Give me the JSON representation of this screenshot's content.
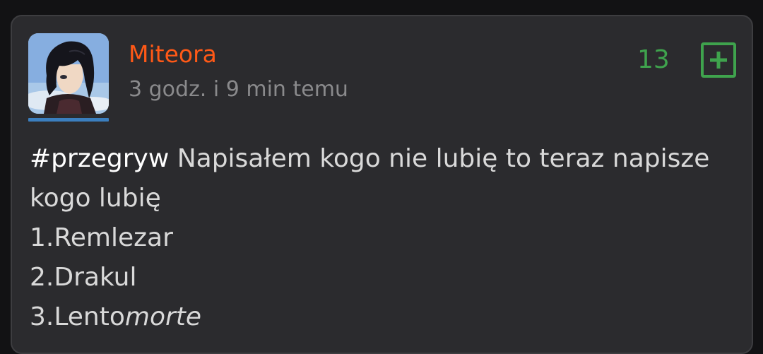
{
  "post": {
    "author": "Miteora",
    "time_ago": "3 godz. i 9 min temu",
    "votes": "13",
    "plus_icon": "plus-square-icon",
    "tag": "#przegryw",
    "line1_rest": " Napisałem kogo nie lubię to teraz napisze",
    "line2": "kogo lubię",
    "line3": "1.Remlezar",
    "line4": "2.Drakul",
    "line5_normal": "3.Lento",
    "line5_italic": "morte"
  },
  "colors": {
    "author": "#ff5917",
    "votes": "#3fa34d",
    "card_bg": "#2b2b2e",
    "page_bg": "#121214",
    "avatar_underline": "#3b7fbf"
  }
}
